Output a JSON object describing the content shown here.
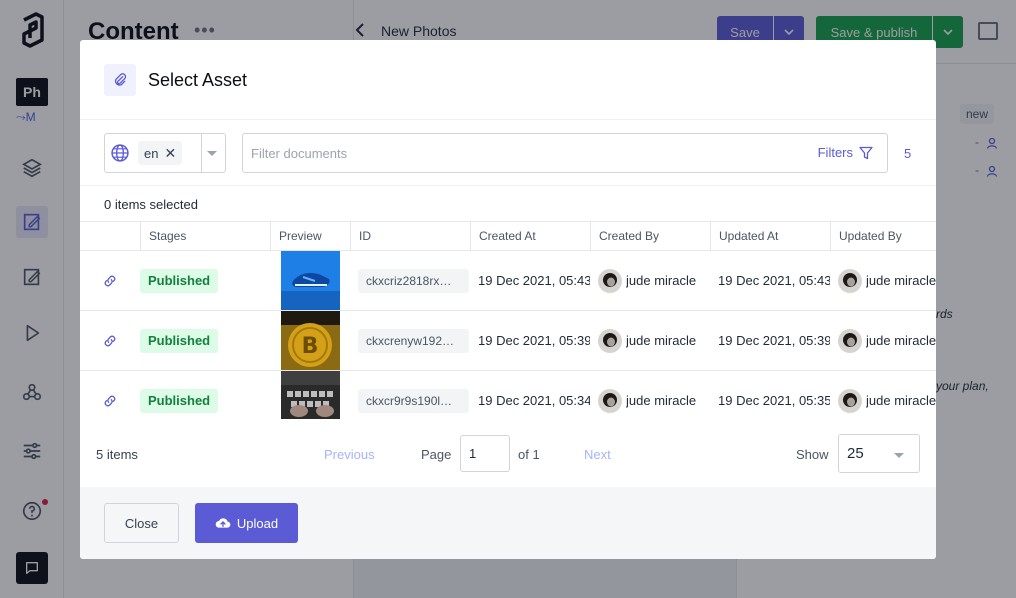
{
  "app": {
    "section_title": "Content",
    "project_initials": "Ph",
    "branch_label": "M"
  },
  "editor": {
    "document_title": "New Photos",
    "save_label": "Save",
    "publish_label": "Save & publish",
    "stage_badge": "new",
    "bg_text_1": "rds",
    "bg_text_2": "your plan,"
  },
  "modal": {
    "title": "Select Asset",
    "locale_chip": "en",
    "filter_placeholder": "Filter documents",
    "filter_value": "",
    "filters_label": "Filters",
    "result_count": "5",
    "selected_text": "0 items selected",
    "columns": [
      {
        "key": "stages",
        "label": "Stages"
      },
      {
        "key": "preview",
        "label": "Preview"
      },
      {
        "key": "id",
        "label": "ID"
      },
      {
        "key": "created_at",
        "label": "Created At"
      },
      {
        "key": "created_by",
        "label": "Created By"
      },
      {
        "key": "updated_at",
        "label": "Updated At"
      },
      {
        "key": "updated_by",
        "label": "Updated By"
      }
    ],
    "rows": [
      {
        "stage": "Published",
        "preview": "blue-sneaker",
        "id": "ckxcriz2818rx…",
        "created_at": "19 Dec 2021, 05:43",
        "created_by": "jude miracle",
        "updated_at": "19 Dec 2021, 05:43",
        "updated_by": "jude miracle"
      },
      {
        "stage": "Published",
        "preview": "bitcoin-coin",
        "id": "ckxcrenyw192…",
        "created_at": "19 Dec 2021, 05:39",
        "created_by": "jude miracle",
        "updated_at": "19 Dec 2021, 05:39",
        "updated_by": "jude miracle"
      },
      {
        "stage": "Published",
        "preview": "keyboard-hands",
        "id": "ckxcr9r9s190l…",
        "created_at": "19 Dec 2021, 05:34",
        "created_by": "jude miracle",
        "updated_at": "19 Dec 2021, 05:35",
        "updated_by": "jude miracle"
      }
    ],
    "pagination": {
      "items_count": "5 items",
      "previous_label": "Previous",
      "page_label": "Page",
      "page_value": "1",
      "of_label": "of 1",
      "next_label": "Next",
      "show_label": "Show",
      "page_size": "25"
    },
    "close_label": "Close",
    "upload_label": "Upload"
  },
  "colors": {
    "accent": "#5b5bd6",
    "publish_green": "#16a34a",
    "published_badge_bg": "#dcfce7",
    "published_badge_text": "#15803d"
  }
}
